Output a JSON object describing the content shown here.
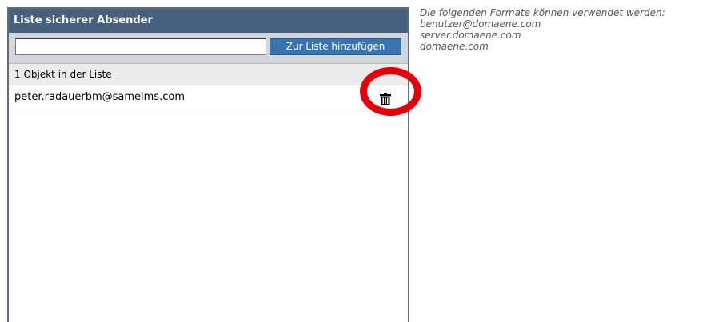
{
  "panel": {
    "title": "Liste sicherer Absender",
    "input_value": "",
    "add_button_label": "Zur Liste hinzufügen",
    "count_text": "1 Objekt in der Liste",
    "items": [
      {
        "email": "peter.radauerbm@samelms.com",
        "action_icon": "trash-icon"
      }
    ]
  },
  "help": {
    "heading": "Die folgenden Formate können verwendet werden:",
    "formats": [
      "benutzer@domaene.com",
      "server.domaene.com",
      "domaene.com"
    ]
  },
  "annotation": {
    "shape": "circle",
    "color": "#e4000b"
  },
  "colors": {
    "header_bg": "#46607f",
    "button_bg": "#3874b0",
    "toolbar_bg": "#d3d6da"
  }
}
